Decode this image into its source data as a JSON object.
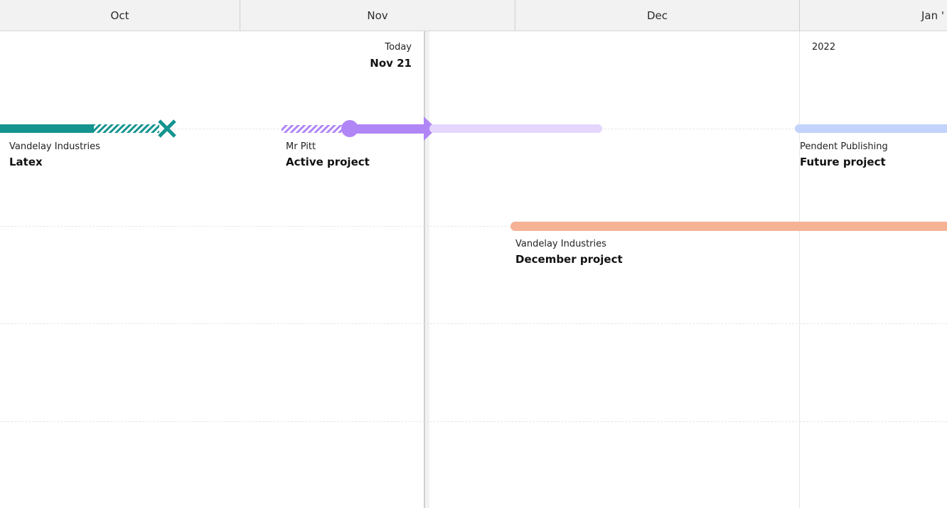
{
  "timeline": {
    "months": [
      "Oct",
      "Nov",
      "Dec",
      "Jan '"
    ],
    "today_label": "Today",
    "today_date": "Nov 21",
    "year_label": "2022"
  },
  "projects": [
    {
      "client": "Vandelay Industries",
      "name": "Latex",
      "status": "cancelled",
      "color": "#14938f"
    },
    {
      "client": "Mr Pitt",
      "name": "Active project",
      "status": "active",
      "color": "#b085f5"
    },
    {
      "client": "Pendent Publishing",
      "name": "Future project",
      "status": "future",
      "color": "#c3d3fb"
    },
    {
      "client": "Vandelay Industries",
      "name": "December project",
      "status": "future",
      "color": "#f5b295"
    }
  ]
}
